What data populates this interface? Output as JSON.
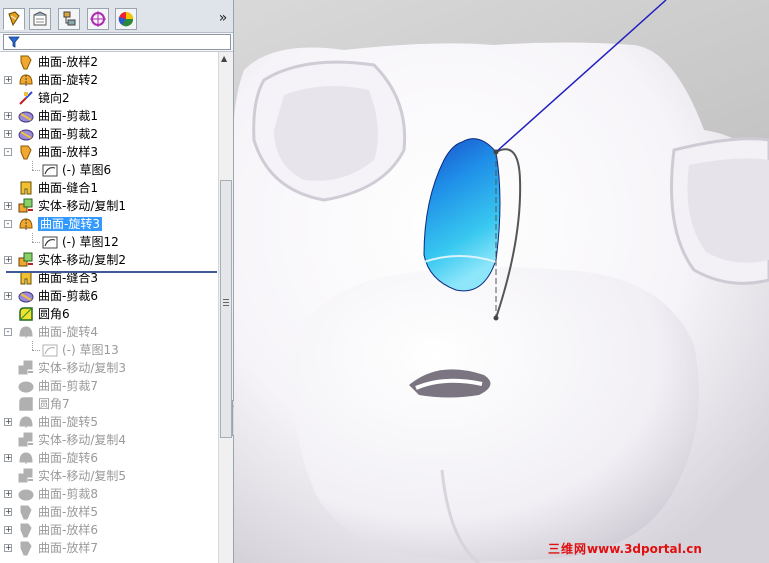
{
  "tabs": [
    {
      "icon": "feature-manager-icon",
      "active": true
    },
    {
      "icon": "property-manager-icon",
      "active": false
    },
    {
      "icon": "configuration-manager-icon",
      "active": false
    },
    {
      "icon": "dimxpert-icon",
      "active": false
    },
    {
      "icon": "display-manager-icon",
      "active": false
    }
  ],
  "expand_glyph": "»",
  "filter_icon": "filter-icon",
  "tree": [
    {
      "label": "曲面-放样2",
      "icon": "surface-loft-icon",
      "indent": 0,
      "toggle": null,
      "grey": false
    },
    {
      "label": "曲面-旋转2",
      "icon": "surface-revolve-icon",
      "indent": 0,
      "toggle": "+",
      "grey": false
    },
    {
      "label": "镜向2",
      "icon": "mirror-icon",
      "indent": 0,
      "toggle": null,
      "grey": false
    },
    {
      "label": "曲面-剪裁1",
      "icon": "surface-trim-icon",
      "indent": 0,
      "toggle": "+",
      "grey": false
    },
    {
      "label": "曲面-剪裁2",
      "icon": "surface-trim-icon",
      "indent": 0,
      "toggle": "+",
      "grey": false
    },
    {
      "label": "曲面-放样3",
      "icon": "surface-loft-icon",
      "indent": 0,
      "toggle": "-",
      "grey": false
    },
    {
      "label": "(-) 草图6",
      "icon": "sketch-icon",
      "indent": 1,
      "toggle": null,
      "grey": false
    },
    {
      "label": "曲面-缝合1",
      "icon": "surface-knit-icon",
      "indent": 0,
      "toggle": null,
      "grey": false
    },
    {
      "label": "实体-移动/复制1",
      "icon": "move-copy-icon",
      "indent": 0,
      "toggle": "+",
      "grey": false
    },
    {
      "label": "曲面-旋转3",
      "icon": "surface-revolve-icon",
      "indent": 0,
      "toggle": "-",
      "grey": false,
      "selected": true
    },
    {
      "label": "(-) 草图12",
      "icon": "sketch-icon",
      "indent": 1,
      "toggle": null,
      "grey": false
    },
    {
      "label": "实体-移动/复制2",
      "icon": "move-copy-icon",
      "indent": 0,
      "toggle": "+",
      "grey": false
    },
    {
      "label": "曲面-缝合3",
      "icon": "surface-knit-icon",
      "indent": 0,
      "toggle": null,
      "grey": false
    },
    {
      "label": "曲面-剪裁6",
      "icon": "surface-trim-icon",
      "indent": 0,
      "toggle": "+",
      "grey": false
    },
    {
      "label": "圆角6",
      "icon": "fillet-icon",
      "indent": 0,
      "toggle": null,
      "grey": false
    },
    {
      "label": "曲面-旋转4",
      "icon": "surface-revolve-icon",
      "indent": 0,
      "toggle": "-",
      "grey": true
    },
    {
      "label": "(-) 草图13",
      "icon": "sketch-icon",
      "indent": 1,
      "toggle": null,
      "grey": true
    },
    {
      "label": "实体-移动/复制3",
      "icon": "move-copy-icon",
      "indent": 0,
      "toggle": null,
      "grey": true
    },
    {
      "label": "曲面-剪裁7",
      "icon": "surface-trim-icon",
      "indent": 0,
      "toggle": null,
      "grey": true
    },
    {
      "label": "圆角7",
      "icon": "fillet-icon",
      "indent": 0,
      "toggle": null,
      "grey": true
    },
    {
      "label": "曲面-旋转5",
      "icon": "surface-revolve-icon",
      "indent": 0,
      "toggle": "+",
      "grey": true
    },
    {
      "label": "实体-移动/复制4",
      "icon": "move-copy-icon",
      "indent": 0,
      "toggle": null,
      "grey": true
    },
    {
      "label": "曲面-旋转6",
      "icon": "surface-revolve-icon",
      "indent": 0,
      "toggle": "+",
      "grey": true
    },
    {
      "label": "实体-移动/复制5",
      "icon": "move-copy-icon",
      "indent": 0,
      "toggle": null,
      "grey": true
    },
    {
      "label": "曲面-剪裁8",
      "icon": "surface-trim-icon",
      "indent": 0,
      "toggle": "+",
      "grey": true
    },
    {
      "label": "曲面-放样5",
      "icon": "surface-loft-icon",
      "indent": 0,
      "toggle": "+",
      "grey": true
    },
    {
      "label": "曲面-放样6",
      "icon": "surface-loft-icon",
      "indent": 0,
      "toggle": "+",
      "grey": true
    },
    {
      "label": "曲面-放样7",
      "icon": "surface-loft-icon",
      "indent": 0,
      "toggle": "+",
      "grey": true
    }
  ],
  "scroll_up": "▲",
  "handle_glyph": "◂▸",
  "watermark": {
    "prefix": "三维网",
    "url": "www.3dportal.cn",
    "color": "#e01010"
  },
  "colors": {
    "selection": "#3399ff",
    "rollback_bar": "#3f5b9c",
    "sketch_line": "#2020c0",
    "viewport_bg": "#bfbfbf"
  }
}
